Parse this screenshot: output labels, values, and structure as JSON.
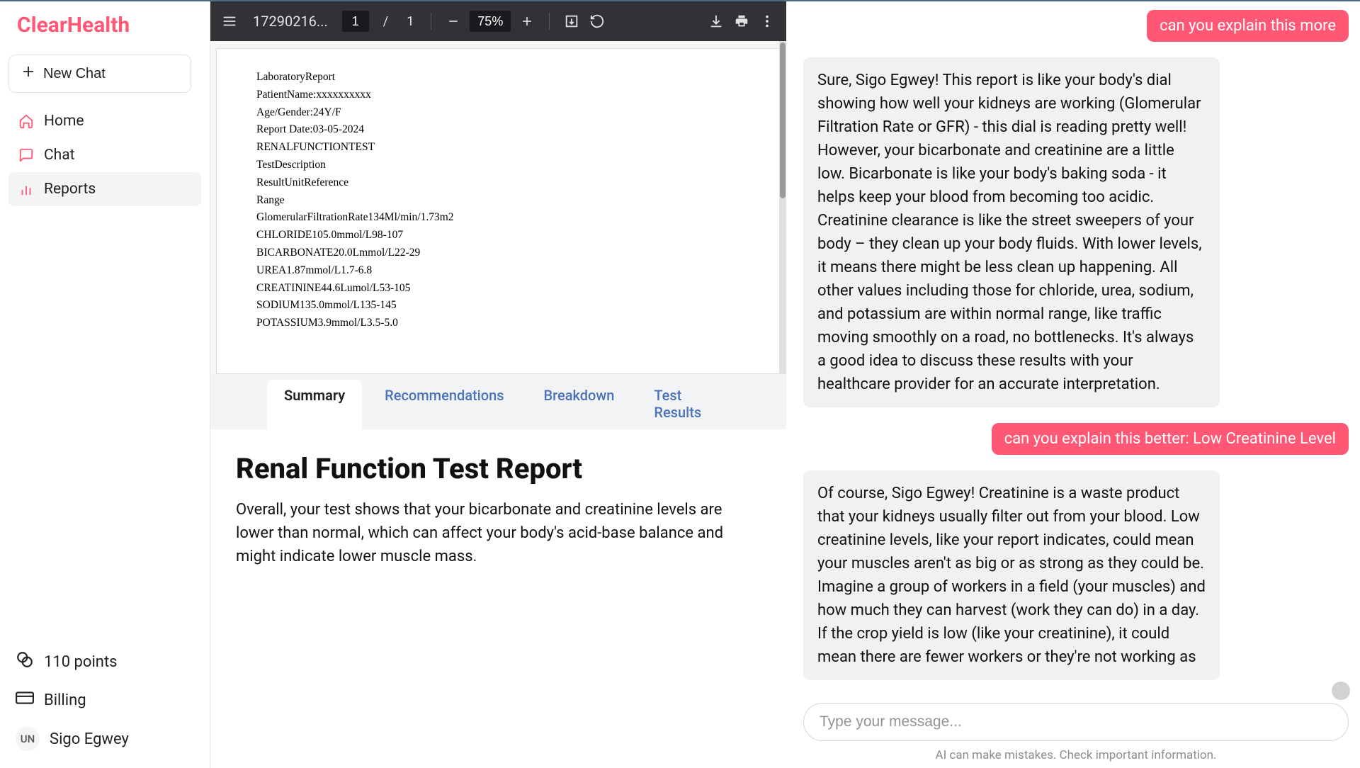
{
  "brand": "ClearHealth",
  "sidebar": {
    "new_chat": "New Chat",
    "items": [
      {
        "label": "Home"
      },
      {
        "label": "Chat"
      },
      {
        "label": "Reports"
      }
    ],
    "points_label": "110 points",
    "billing_label": "Billing",
    "user_initials": "UN",
    "user_name": "Sigo Egwey"
  },
  "pdf": {
    "title": "17290216...",
    "page_current": "1",
    "page_sep": "/",
    "page_total": "1",
    "zoom": "75%",
    "lines": [
      "LaboratoryReport",
      "PatientName:xxxxxxxxxx",
      "Age/Gender:24Y/F",
      "Report Date:03-05-2024",
      "RENALFUNCTIONTEST",
      "TestDescription",
      "ResultUnitReference",
      "Range",
      "GlomerularFiltrationRate134Ml/min/1.73m2",
      "CHLORIDE105.0mmol/L98-107",
      "BICARBONATE20.0Lmmol/L22-29",
      "UREA1.87mmol/L1.7-6.8",
      "CREATININE44.6Lumol/L53-105",
      "SODIUM135.0mmol/L135-145",
      "POTASSIUM3.9mmol/L3.5-5.0"
    ]
  },
  "tabs": [
    "Summary",
    "Recommendations",
    "Breakdown",
    "Test Results"
  ],
  "report": {
    "title": "Renal Function Test Report",
    "summary": "Overall, your test shows that your bicarbonate and creatinine levels are lower than normal, which can affect your body's acid-base balance and might indicate lower muscle mass."
  },
  "chat": {
    "messages": [
      {
        "role": "user",
        "text": "can you explain this more"
      },
      {
        "role": "ai",
        "text": "Sure, Sigo Egwey! This report is like your body's dial showing how well your kidneys are working (Glomerular Filtration Rate or GFR) - this dial is reading pretty well! However, your bicarbonate and creatinine are a little low. Bicarbonate is like your body's baking soda - it helps keep your blood from becoming too acidic. Creatinine clearance is like the street sweepers of your body – they clean up your body fluids. With lower levels, it means there might be less clean up happening. All other values including those for chloride, urea, sodium, and potassium are within normal range, like traffic moving smoothly on a road, no bottlenecks. It's always a good idea to discuss these results with your healthcare provider for an accurate interpretation."
      },
      {
        "role": "user",
        "text": "can you explain this better: Low Creatinine Level"
      },
      {
        "role": "ai",
        "text": "Of course, Sigo Egwey! Creatinine is a waste product that your kidneys usually filter out from your blood. Low creatinine levels, like your report indicates, could mean your muscles aren't as big or as strong as they could be. Imagine a group of workers in a field (your muscles) and how much they can harvest (work they can do) in a day. If the crop yield is low (like your creatinine), it could mean there are fewer workers or they're not working as"
      }
    ],
    "placeholder": "Type your message...",
    "disclaimer": "AI can make mistakes. Check important information."
  }
}
